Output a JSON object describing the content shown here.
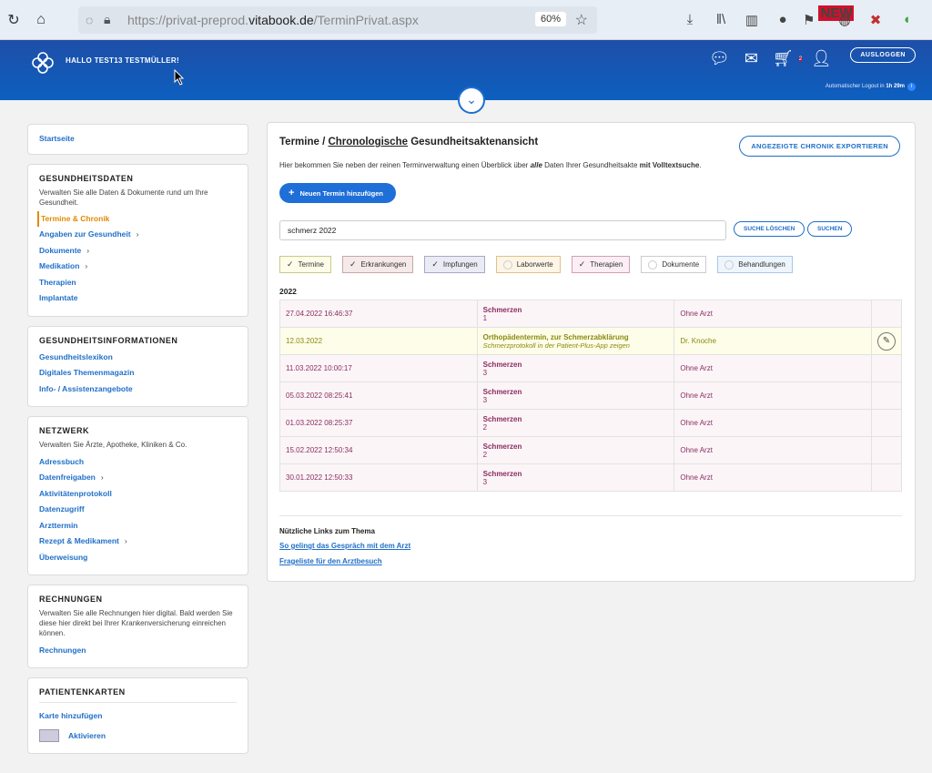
{
  "browser": {
    "url_prefix": "https://privat-preprod.",
    "url_domain": "vitabook.de",
    "url_path": "/TerminPrivat.aspx",
    "zoom": "60%",
    "new_badge": "NEW"
  },
  "header": {
    "greeting": "HALLO TEST13 TESTMÜLLER!",
    "logout_label": "AUSLOGGEN",
    "cart_count": "2",
    "auto_logout_label": "Automatischer Logout in",
    "auto_logout_time": "1h 29m",
    "info_glyph": "i"
  },
  "sidebar": {
    "startseite": "Startseite",
    "gesundheitsdaten": {
      "title": "GESUNDHEITSDATEN",
      "desc": "Verwalten Sie alle Daten & Dokumente rund um Ihre Gesundheit.",
      "items": [
        "Termine & Chronik",
        "Angaben zur Gesundheit",
        "Dokumente",
        "Medikation",
        "Therapien",
        "Implantate"
      ]
    },
    "gesundheitsinfo": {
      "title": "GESUNDHEITSINFORMATIONEN",
      "items": [
        "Gesundheitslexikon",
        "Digitales Themenmagazin",
        "Info- / Assistenzangebote"
      ]
    },
    "netzwerk": {
      "title": "NETZWERK",
      "desc": "Verwalten Sie Ärzte, Apotheke, Kliniken & Co.",
      "items": [
        "Adressbuch",
        "Datenfreigaben",
        "Aktivitätenprotokoll",
        "Datenzugriff",
        "Arzttermin",
        "Rezept & Medikament",
        "Überweisung"
      ]
    },
    "rechnungen": {
      "title": "RECHNUNGEN",
      "desc": "Verwalten Sie alle Rechnungen hier digital. Bald werden Sie diese hier direkt bei Ihrer Krankenversicherung einreichen können.",
      "link": "Rechnungen"
    },
    "patientenkarten": {
      "title": "PATIENTENKARTEN",
      "add": "Karte hinzufügen",
      "activate": "Aktivieren"
    }
  },
  "main": {
    "title_pre": "Termine / ",
    "title_u": "Chronologische",
    "title_post": " Gesundheitsaktenansicht",
    "export_label": "ANGEZEIGTE CHRONIK EXPORTIEREN",
    "intro_1": "Hier bekommen Sie neben der reinen Terminverwaltung einen Überblick über ",
    "intro_em": "alle",
    "intro_2": " Daten Ihrer Gesundheitsakte ",
    "intro_b": "mit Volltextsuche",
    "intro_3": ".",
    "new_label": "Neuen Termin hinzufügen",
    "search_value": "schmerz 2022",
    "clear_label": "SUCHE LÖSCHEN",
    "search_label": "SUCHEN",
    "filters": [
      {
        "label": "Termine",
        "checked": true,
        "bg": "#fdfde9",
        "border": "#c9c98a"
      },
      {
        "label": "Erkrankungen",
        "checked": true,
        "bg": "#f5e9e9",
        "border": "#c8a8a8"
      },
      {
        "label": "Impfungen",
        "checked": true,
        "bg": "#ebebf5",
        "border": "#a8a8c8"
      },
      {
        "label": "Laborwerte",
        "checked": false,
        "bg": "#fdf5e6",
        "border": "#e0c08a"
      },
      {
        "label": "Therapien",
        "checked": true,
        "bg": "#fbeef4",
        "border": "#d0a0b8"
      },
      {
        "label": "Dokumente",
        "checked": false,
        "bg": "#ffffff",
        "border": "#cccccc"
      },
      {
        "label": "Behandlungen",
        "checked": false,
        "bg": "#eef5fd",
        "border": "#a8c8e8"
      }
    ],
    "year": "2022",
    "rows": [
      {
        "date": "27.04.2022 16:46:37",
        "title": "Schmerzen",
        "sub": "1",
        "doctor": "Ohne Arzt",
        "type": "pink"
      },
      {
        "date": "12.03.2022",
        "title": "Orthopädentermin, zur Schmerzabklärung",
        "sub": "Schmerzprotokoll in der Patient-Plus-App zeigen",
        "doctor": "Dr. Knoche",
        "type": "yellow"
      },
      {
        "date": "11.03.2022 10:00:17",
        "title": "Schmerzen",
        "sub": "3",
        "doctor": "Ohne Arzt",
        "type": "pink"
      },
      {
        "date": "05.03.2022 08:25:41",
        "title": "Schmerzen",
        "sub": "3",
        "doctor": "Ohne Arzt",
        "type": "pink"
      },
      {
        "date": "01.03.2022 08:25:37",
        "title": "Schmerzen",
        "sub": "2",
        "doctor": "Ohne Arzt",
        "type": "pink"
      },
      {
        "date": "15.02.2022 12:50:34",
        "title": "Schmerzen",
        "sub": "2",
        "doctor": "Ohne Arzt",
        "type": "pink"
      },
      {
        "date": "30.01.2022 12:50:33",
        "title": "Schmerzen",
        "sub": "3",
        "doctor": "Ohne Arzt",
        "type": "pink"
      }
    ],
    "useful_title": "Nützliche Links zum Thema",
    "useful_links": [
      "So gelingt das Gespräch mit dem Arzt",
      "Frageliste für den Arztbesuch"
    ]
  }
}
